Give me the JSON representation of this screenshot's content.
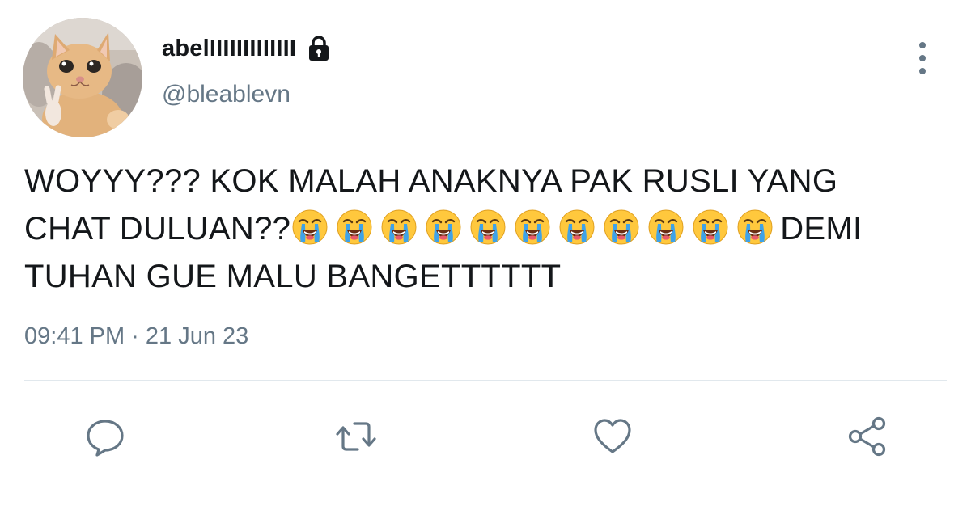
{
  "tweet": {
    "display_name": "abelIIIIIIIIIIIII",
    "handle": "@bleablevn",
    "text_line1": "WOYYY??? KOK MALAH ANAKNYA PAK RUSLI YANG",
    "text_line2_prefix": "CHAT DULUAN??",
    "emoji_count": 11,
    "emoji_name": "loudly-crying-face",
    "text_line2_suffix": "DEMI",
    "text_line3": "TUHAN GUE MALU BANGETTTTTT",
    "timestamp": "09:41 PM · 21 Jun 23"
  },
  "icons": {
    "lock": "lock-icon",
    "more": "more-vertical-icon",
    "reply": "reply-icon",
    "retweet": "retweet-icon",
    "like": "heart-icon",
    "share": "share-icon"
  },
  "colors": {
    "text": "#14171a",
    "secondary": "#657786",
    "divider": "#e1e8ed",
    "emoji_face": "#ffc83d",
    "tears": "#3fa2e8"
  }
}
